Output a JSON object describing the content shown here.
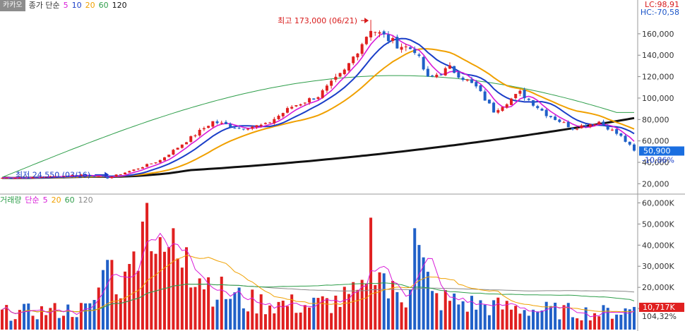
{
  "price_legend": {
    "tag": "카카오",
    "label": "종가 단순",
    "periods": [
      "5",
      "10",
      "20",
      "60",
      "120"
    ],
    "period_colors": [
      "#d81bd8",
      "#1a3ec8",
      "#f0a000",
      "#2e9e4a",
      "#111111"
    ]
  },
  "volume_legend": {
    "label": "거래량",
    "method": "단순",
    "periods": [
      "5",
      "20",
      "60",
      "120"
    ],
    "period_colors": [
      "#d81bd8",
      "#f0a000",
      "#2e9e4a",
      "#888888"
    ]
  },
  "readouts": {
    "lc": "LC:98,91",
    "hc": "HC:-70,58",
    "current_price": "50,900",
    "current_change": "-10,86%",
    "current_volume": "10,717K",
    "volume_ratio": "104,32%"
  },
  "colors": {
    "up": "#e02020",
    "down": "#2060c8",
    "price_label_bg": "#1a6ee0",
    "volume_label_bg": "#e02020"
  },
  "chart_data": [
    {
      "type": "candlestick",
      "y_ticks": [
        "160,000",
        "140,000",
        "120,000",
        "100,000",
        "80,000",
        "60,000",
        "40,000",
        "20,000"
      ],
      "y_tick_values": [
        160000,
        140000,
        120000,
        100000,
        80000,
        60000,
        40000,
        20000
      ],
      "ylim": [
        13000,
        181000
      ],
      "annotations": [
        {
          "text": "최고 173,000 (06/21)",
          "value": 173000,
          "index": 84
        },
        {
          "text": "최저 24,550 (03/16)",
          "value": 24550,
          "index": 24
        }
      ],
      "anchors": [
        [
          0,
          25500
        ],
        [
          6,
          25800
        ],
        [
          12,
          26800
        ],
        [
          18,
          28500
        ],
        [
          24,
          25500
        ],
        [
          30,
          33000
        ],
        [
          36,
          42000
        ],
        [
          42,
          60000
        ],
        [
          48,
          78000
        ],
        [
          54,
          72000
        ],
        [
          60,
          75000
        ],
        [
          66,
          92000
        ],
        [
          72,
          102000
        ],
        [
          78,
          125000
        ],
        [
          84,
          165000
        ],
        [
          90,
          150000
        ],
        [
          94,
          145000
        ],
        [
          97,
          118000
        ],
        [
          102,
          128000
        ],
        [
          108,
          110000
        ],
        [
          112,
          88000
        ],
        [
          118,
          105000
        ],
        [
          124,
          85000
        ],
        [
          130,
          72000
        ],
        [
          136,
          78000
        ],
        [
          141,
          64000
        ],
        [
          144,
          51000
        ]
      ],
      "moving_averages": [
        {
          "period": "5",
          "color": "#d81bd8"
        },
        {
          "period": "10",
          "color": "#1a3ec8"
        },
        {
          "period": "20",
          "color": "#f0a000"
        },
        {
          "period": "60",
          "color": "#2e9e4a"
        },
        {
          "period": "120",
          "color": "#111111"
        }
      ]
    },
    {
      "type": "bar",
      "y_ticks": [
        "60,000K",
        "50,000K",
        "40,000K",
        "30,000K",
        "20,000K",
        "10,000K"
      ],
      "y_tick_values": [
        60000,
        50000,
        40000,
        30000,
        20000,
        10000
      ],
      "ylim": [
        0,
        62500
      ],
      "volume_anchors": [
        [
          0,
          9000
        ],
        [
          10,
          10000
        ],
        [
          20,
          11000
        ],
        [
          24,
          33000
        ],
        [
          28,
          24000
        ],
        [
          30,
          37000
        ],
        [
          33,
          60000
        ],
        [
          36,
          36000
        ],
        [
          39,
          48000
        ],
        [
          42,
          39000
        ],
        [
          46,
          28000
        ],
        [
          50,
          20000
        ],
        [
          56,
          15000
        ],
        [
          62,
          14000
        ],
        [
          70,
          13000
        ],
        [
          76,
          15000
        ],
        [
          82,
          19000
        ],
        [
          84,
          53000
        ],
        [
          88,
          20000
        ],
        [
          92,
          18000
        ],
        [
          94,
          48000
        ],
        [
          98,
          17000
        ],
        [
          106,
          14000
        ],
        [
          110,
          13000
        ],
        [
          114,
          12000
        ],
        [
          120,
          11000
        ],
        [
          128,
          10000
        ],
        [
          136,
          9000
        ],
        [
          144,
          10717
        ]
      ]
    }
  ]
}
